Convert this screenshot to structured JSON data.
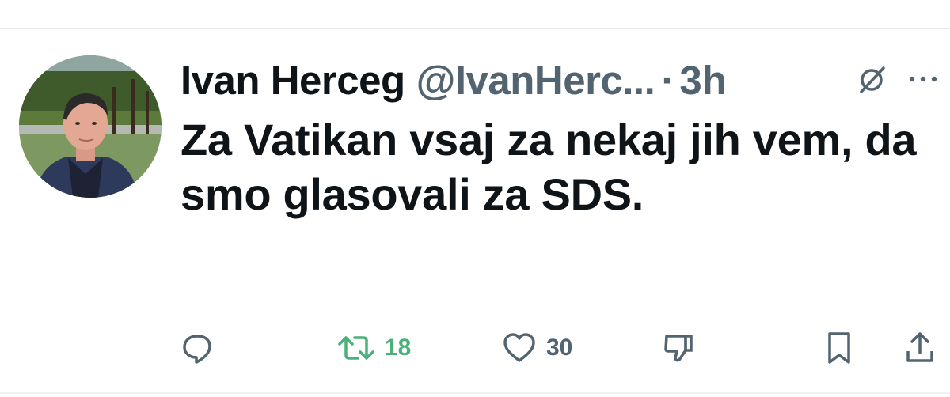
{
  "author": {
    "display_name": "Ivan Herceg",
    "handle": "@IvanHerc...",
    "separator": "·",
    "time": "3h"
  },
  "tweet": {
    "text": "Za Vatikan vsaj za nekaj jih vem, da smo glasovali za SDS."
  },
  "actions": {
    "reply": {
      "icon": "reply-icon",
      "count": ""
    },
    "retweet": {
      "icon": "retweet-icon",
      "count": "18",
      "color": "#4bb07a"
    },
    "like": {
      "icon": "heart-icon",
      "count": "30"
    },
    "dislike": {
      "icon": "thumbs-down-icon",
      "count": ""
    },
    "bookmark": {
      "icon": "bookmark-icon",
      "count": ""
    },
    "share": {
      "icon": "share-icon",
      "count": ""
    }
  },
  "colors": {
    "text_primary": "#0f1419",
    "text_secondary": "#536471",
    "retweet_active": "#4bb07a"
  }
}
